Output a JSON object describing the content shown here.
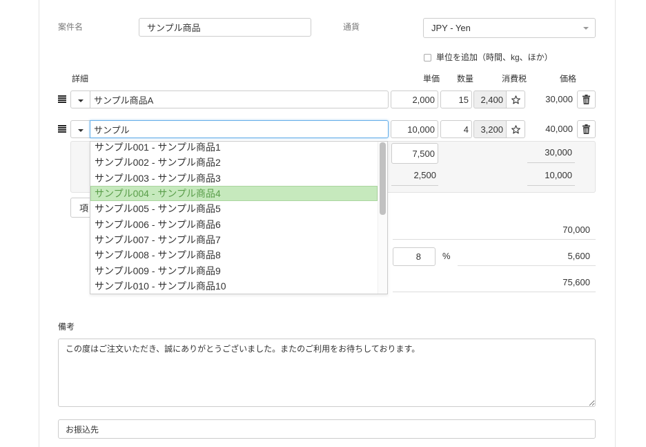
{
  "header": {
    "project_label": "案件名",
    "project_value": "サンプル商品",
    "currency_label": "通貨",
    "currency_value": "JPY - Yen",
    "add_unit_label": "単位を追加（時間、kg、ほか）",
    "add_unit_checked": false
  },
  "columns": {
    "detail": "詳細",
    "unit_price": "単価",
    "quantity": "数量",
    "tax": "消費税",
    "price": "価格"
  },
  "line_items": [
    {
      "name": "サンプル商品A",
      "unit_price": "2,000",
      "quantity": "15",
      "tax": "2,400",
      "price": "30,000"
    },
    {
      "name": "サンプル",
      "unit_price": "10,000",
      "quantity": "4",
      "tax": "3,200",
      "price": "40,000",
      "sub_items": [
        {
          "unit_price": "7,500",
          "price": "30,000"
        },
        {
          "unit_price": "2,500",
          "price": "10,000"
        }
      ]
    }
  ],
  "add_item_label": "項",
  "autocomplete": {
    "options": [
      "サンプル001 - サンプル商品1",
      "サンプル002 - サンプル商品2",
      "サンプル003 - サンプル商品3",
      "サンプル004 - サンプル商品4",
      "サンプル005 - サンプル商品5",
      "サンプル006 - サンプル商品6",
      "サンプル007 - サンプル商品7",
      "サンプル008 - サンプル商品8",
      "サンプル009 - サンプル商品9",
      "サンプル010 - サンプル商品10"
    ],
    "highlighted_index": 3
  },
  "totals": {
    "subtotal": "70,000",
    "tax_rate": "8",
    "tax_rate_unit": "%",
    "tax_amount": "5,600",
    "total": "75,600"
  },
  "notes": {
    "label": "備考",
    "value": "この度はご注文いただき、誠にありがとうございました。またのご利用をお待ちしております。"
  },
  "bank": {
    "value": "お振込先"
  },
  "icons": {
    "drag_handle": "drag-handle-icon",
    "item_menu": "caret-down-icon",
    "select_arrow": "chevron-down-icon",
    "tax_toggle": "star-outline-icon",
    "delete": "trash-icon"
  },
  "colors": {
    "focus_border": "#66afe9",
    "highlight_bg": "#c6e9bd",
    "highlight_text": "#5a9e4a",
    "readonly_bg": "#eeeeee",
    "scroll_thumb": "#c1c1c1"
  }
}
